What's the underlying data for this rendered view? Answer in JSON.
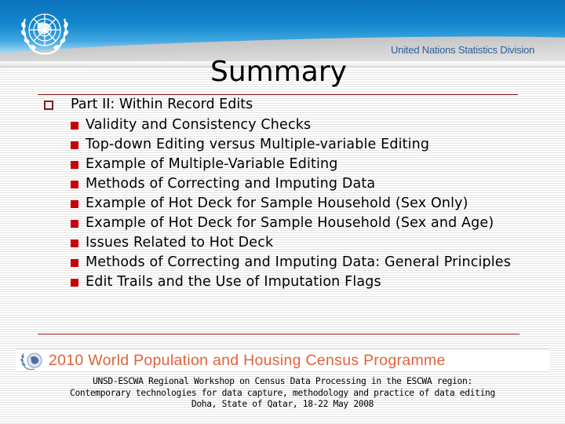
{
  "header": {
    "organization": "United Nations Statistics Division",
    "logo_icon": "un-emblem-icon"
  },
  "slide": {
    "title": "Summary",
    "section": {
      "label": "Part II: Within Record Edits",
      "bullet_icon": "hollow-square-bullet-icon",
      "items": [
        {
          "label": "Validity and Consistency Checks"
        },
        {
          "label": "Top-down Editing versus Multiple-variable Editing"
        },
        {
          "label": "Example of Multiple-Variable Editing"
        },
        {
          "label": "Methods of Correcting and Imputing Data"
        },
        {
          "label": "Example of Hot Deck for Sample Household (Sex Only)"
        },
        {
          "label": "Example of Hot Deck for Sample Household (Sex and Age)"
        },
        {
          "label": "Issues Related to Hot Deck"
        },
        {
          "label": "Methods of Correcting and Imputing Data: General Principles"
        },
        {
          "label": "Edit Trails and the Use of Imputation Flags"
        }
      ]
    }
  },
  "banner": {
    "text": "2010 World Population and Housing Census Programme",
    "logo_icon": "census-programme-logo-icon"
  },
  "footer": {
    "line1": "UNSD-ESCWA Regional Workshop on Census Data Processing in the ESCWA region:",
    "line2": "Contemporary technologies for data capture, methodology and practice of data editing",
    "line3": "Doha, State of Qatar, 18-22 May 2008"
  },
  "colors": {
    "header_blue": "#0b74bd",
    "title_rule": "#8b1a1a",
    "bullet_red": "#c8000a",
    "banner_orange": "#e0623a",
    "unsd_text": "#2d5f9a"
  }
}
